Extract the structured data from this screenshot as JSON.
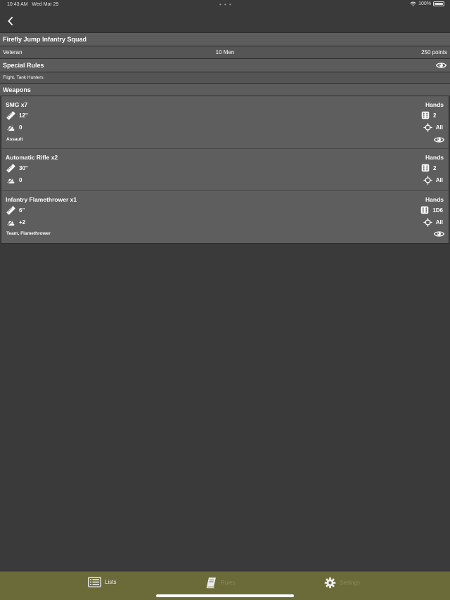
{
  "status_bar": {
    "time": "10:43 AM",
    "date": "Wed Mar 29",
    "battery": "100%"
  },
  "nav": {
    "back_icon": "chevron-left-icon"
  },
  "unit": {
    "name": "Firefly Jump Infantry Squad",
    "rating": "Veteran",
    "size": "10 Men",
    "points": "250 points"
  },
  "special_rules": {
    "header": "Special Rules",
    "text": "Flight, Tank Hunters"
  },
  "weapons": {
    "header": "Weapons",
    "items": [
      {
        "name": "SMG x7",
        "type": "Hands",
        "range": "12\"",
        "shots": "2",
        "pen": "0",
        "arc": "All",
        "rules": "Assault"
      },
      {
        "name": "Automatic Rifle x2",
        "type": "Hands",
        "range": "30\"",
        "shots": "2",
        "pen": "0",
        "arc": "All",
        "rules": ""
      },
      {
        "name": "Infantry Flamethrower x1",
        "type": "Hands",
        "range": "6\"",
        "shots": "1D6",
        "pen": "+2",
        "arc": "All",
        "rules": "Team, Flamethrower"
      }
    ]
  },
  "tabbar": {
    "lists": "Lists",
    "rules": "Rules",
    "settings": "Settings"
  },
  "colors": {
    "background": "#3a3a3a",
    "row": "#5c5c5c",
    "tabbar": "#6b6b3a"
  }
}
